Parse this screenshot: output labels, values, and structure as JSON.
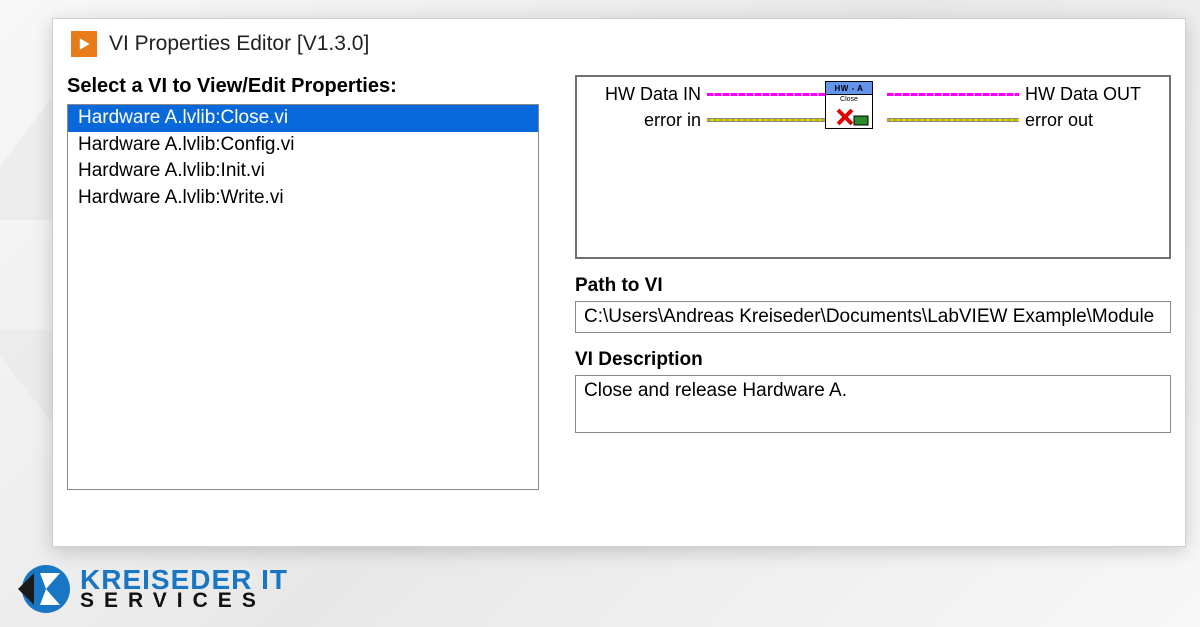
{
  "window": {
    "title": "VI Properties Editor [V1.3.0]"
  },
  "selector": {
    "label": "Select a VI to View/Edit Properties:",
    "items": [
      "Hardware A.lvlib:Close.vi",
      "Hardware A.lvlib:Config.vi",
      "Hardware A.lvlib:Init.vi",
      "Hardware A.lvlib:Write.vi"
    ],
    "selected_index": 0
  },
  "connector": {
    "left_top": "HW Data IN",
    "right_top": "HW Data OUT",
    "left_bottom": "error in",
    "right_bottom": "error out",
    "icon_header": "HW - A",
    "icon_sub": "Close"
  },
  "path": {
    "label": "Path to VI",
    "value": "C:\\Users\\Andreas Kreiseder\\Documents\\LabVIEW Example\\Module"
  },
  "description": {
    "label": "VI Description",
    "value": "Close and release Hardware A."
  },
  "branding": {
    "line1": "KREISEDER IT",
    "line2": "SERVICES"
  }
}
